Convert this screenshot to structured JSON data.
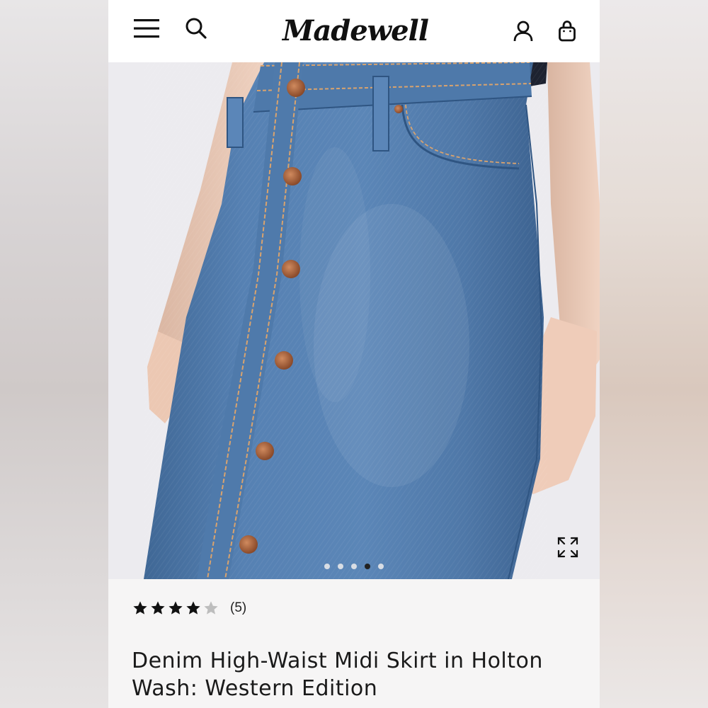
{
  "header": {
    "logo": "Madewell",
    "icons": {
      "menu": "menu-icon",
      "search": "search-icon",
      "account": "account-icon",
      "bag": "bag-icon"
    }
  },
  "gallery": {
    "image_alt": "Model wearing a button-front denim midi skirt",
    "dot_count": 5,
    "active_index": 3,
    "expand_icon": "expand-icon"
  },
  "product": {
    "rating": 4,
    "rating_max": 5,
    "review_count": "(5)",
    "title": "Denim High-Waist Midi Skirt in Holton Wash: Western Edition"
  },
  "colors": {
    "denim": "#4f77a6",
    "denim_dark": "#3b5f8c",
    "button_copper": "#a8603a",
    "text": "#1a1a1a"
  }
}
